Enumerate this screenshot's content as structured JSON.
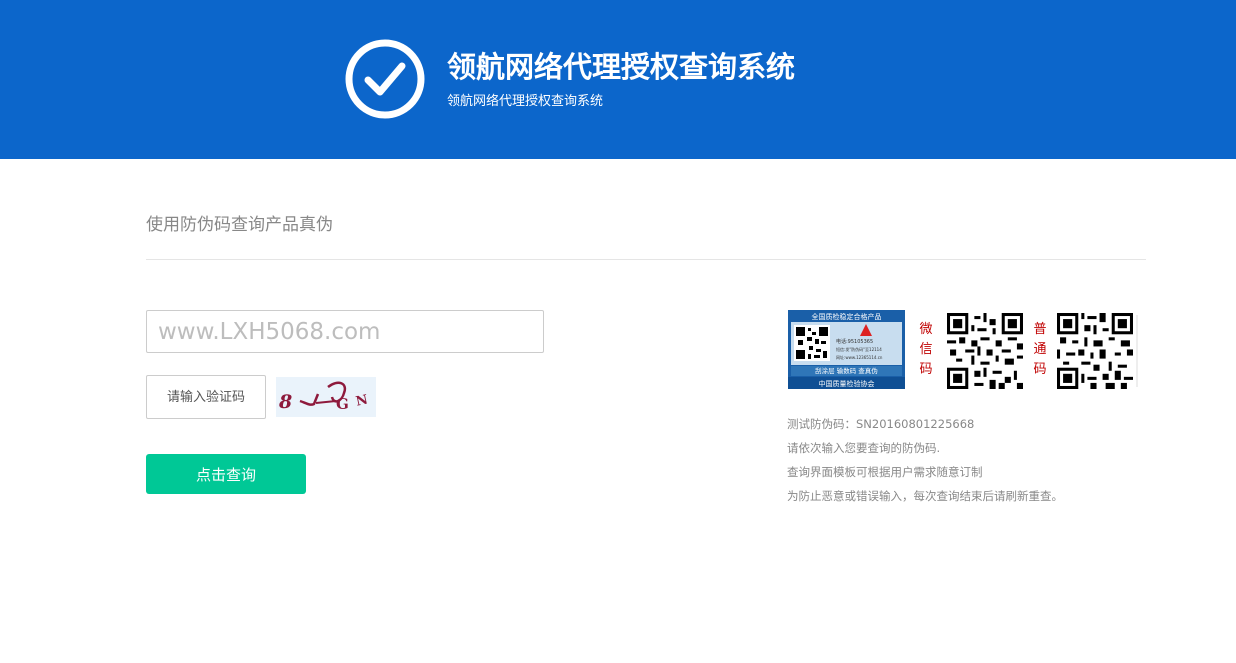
{
  "header": {
    "title": "领航网络代理授权查询系统",
    "subtitle": "领航网络代理授权查询系统",
    "logo_icon": "check-circle-icon",
    "bg_color": "#0c66cb"
  },
  "main": {
    "section_title": "使用防伪码查询产品真伪",
    "code_input": {
      "value": "",
      "placeholder": "www.LXH5068.com"
    },
    "captcha_input": {
      "value": "",
      "placeholder": "请输入验证码"
    },
    "captcha_image": {
      "text": "8 V G N"
    },
    "submit_label": "点击查询",
    "submit_color": "#00c896"
  },
  "sidebar": {
    "label_card": {
      "top_text": "全国质检稳定合格产品",
      "phone": "电话:95105365",
      "note": "短信:发\"防伪码\"至12114",
      "site": "网址:www.12365114.cn",
      "mid_text": "刮涂层  输数码  查真伪",
      "bottom_text": "中国质量检验协会"
    },
    "wechat_label": "微信码",
    "normal_label": "普通码",
    "info": [
      "测试防伪码：SN20160801225668",
      "请依次输入您要查询的防伪码.",
      "查询界面模板可根据用户需求随意订制",
      "为防止恶意或错误输入，每次查询结束后请刷新重查。"
    ]
  }
}
